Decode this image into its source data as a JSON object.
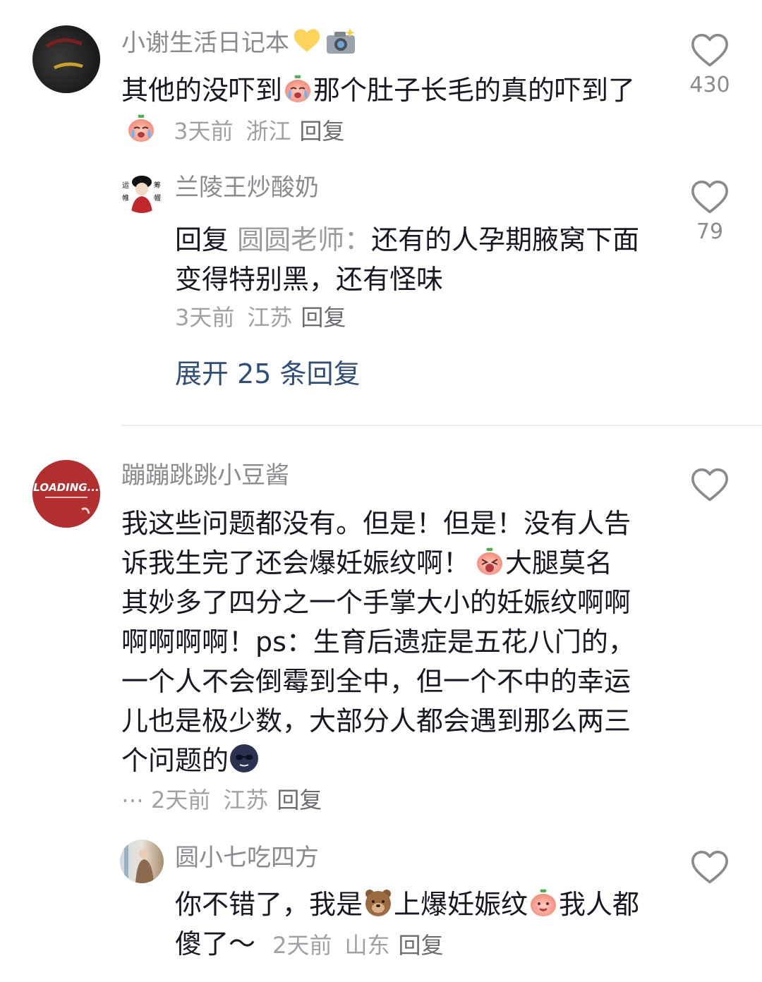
{
  "comments": [
    {
      "username": "小谢生活日记本",
      "username_icons": [
        "yellow-heart-icon",
        "camera-flash-icon"
      ],
      "text_a": "其他的没吓到",
      "text_b": "那个肚子长毛的真的吓到了",
      "time": "3天前",
      "location": "浙江",
      "reply_label": "回复",
      "likes": "430",
      "replies": [
        {
          "username": "兰陵王炒酸奶",
          "reply_prefix": "回复",
          "quoted_user": "圆圆老师：",
          "text": "还有的人孕期腋窝下面变得特别黑，还有怪味",
          "time": "3天前",
          "location": "江苏",
          "reply_label": "回复",
          "likes": "79"
        }
      ],
      "expand_label": "展开 25 条回复"
    },
    {
      "username": "蹦蹦跳跳小豆酱",
      "avatar_text": "LOADING...",
      "text_a": "我这些问题都没有。但是！但是！没有人告诉我生完了还会爆妊娠纹啊！",
      "text_b": "大腿莫名其妙多了四分之一个手掌大小的妊娠纹啊啊啊啊啊啊！ps：生育后遗症是五花八门的，一个人不会倒霉到全中，但一个不中的幸运儿也是极少数，大部分人都会遇到那么两三个问题的",
      "ellipsis": "⋯",
      "time": "2天前",
      "location": "江苏",
      "reply_label": "回复",
      "replies": [
        {
          "username": "圆小七吃四方",
          "text_a": "你不错了，我是",
          "text_b": "上爆妊娠纹",
          "text_c": "我人都傻了～",
          "time": "2天前",
          "location": "山东",
          "reply_label": "回复"
        }
      ]
    }
  ]
}
